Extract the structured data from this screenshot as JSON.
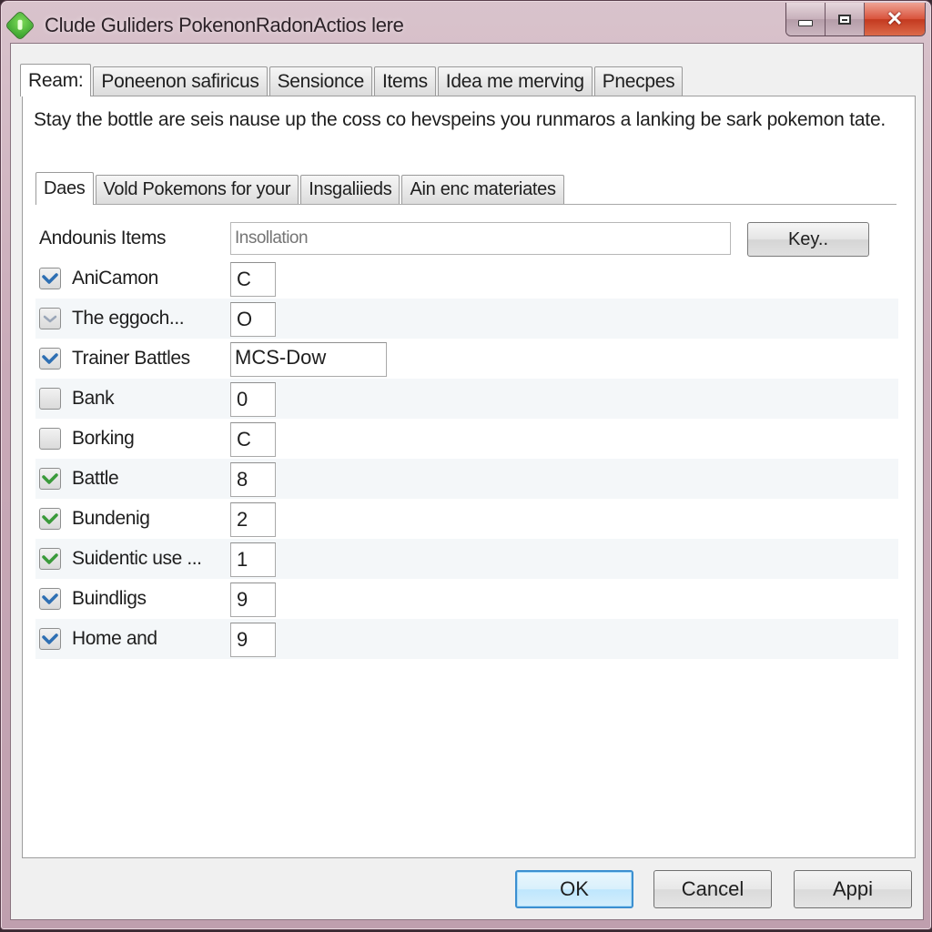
{
  "window": {
    "title": "Clude Guliders PokenonRadonActios lere",
    "controls": {
      "minimize": "minimize",
      "maximize": "maximize",
      "close": "✕"
    }
  },
  "top_tabs": [
    {
      "label": "Ream:",
      "active": true
    },
    {
      "label": "Poneenon safiricus",
      "active": false
    },
    {
      "label": "Sensionce",
      "active": false
    },
    {
      "label": "Items",
      "active": false
    },
    {
      "label": "Idea me merving",
      "active": false
    },
    {
      "label": "Pnecpes",
      "active": false
    }
  ],
  "description": "Stay the bottle are seis nause up the coss co hevspeins you runmaros a lanking be sark pokemon tate.",
  "inner_tabs": [
    {
      "label": "Daes",
      "active": true
    },
    {
      "label": "Vold Pokemons for your",
      "active": false
    },
    {
      "label": "Insgaliieds",
      "active": false
    },
    {
      "label": "Ain enc materiates",
      "active": false
    }
  ],
  "path_row": {
    "label": "Andounis Items",
    "placeholder": "Insollation",
    "button_label": "Key.."
  },
  "items": [
    {
      "label": "AniCamon",
      "checked": true,
      "check_color": "#2e6fb3",
      "value": "C"
    },
    {
      "label": "The eggoch...",
      "checked": "indeterminate",
      "check_color": "#9aa6b8",
      "value": "O"
    },
    {
      "label": "Trainer Battles",
      "checked": true,
      "check_color": "#2e6fb3",
      "value": "MCS-Dow"
    },
    {
      "label": "Bank",
      "checked": false,
      "value": "0"
    },
    {
      "label": "Borking",
      "checked": false,
      "value": "C"
    },
    {
      "label": "Battle",
      "checked": true,
      "check_color": "#3a9a3a",
      "value": "8"
    },
    {
      "label": "Bundenig",
      "checked": true,
      "check_color": "#3a9a3a",
      "value": "2"
    },
    {
      "label": "Suidentic use ...",
      "checked": true,
      "check_color": "#3a9a3a",
      "value": "1"
    },
    {
      "label": "Buindligs",
      "checked": true,
      "check_color": "#2e6fb3",
      "value": "9"
    },
    {
      "label": "Home and",
      "checked": true,
      "check_color": "#2e6fb3",
      "value": "9"
    }
  ],
  "buttons": {
    "ok": "OK",
    "cancel": "Cancel",
    "apply": "Appi"
  }
}
